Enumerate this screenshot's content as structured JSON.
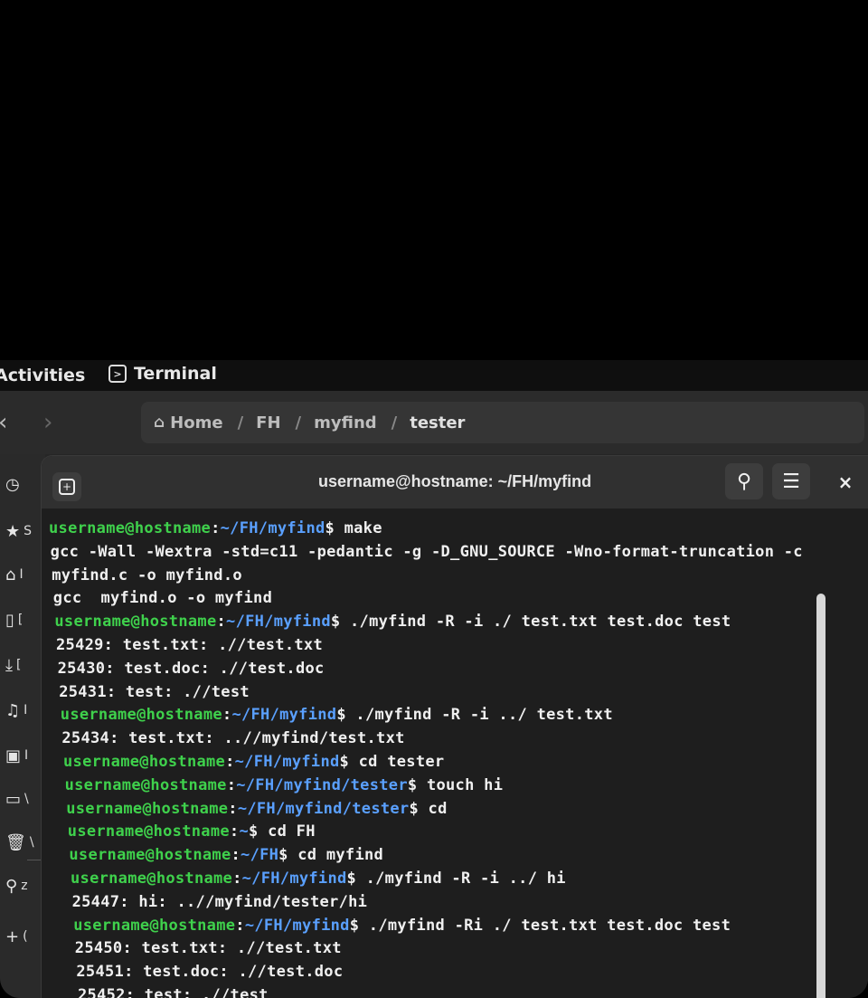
{
  "topbar": {
    "activities": "Activities",
    "app_name": "Terminal"
  },
  "files": {
    "breadcrumb": [
      "Home",
      "FH",
      "myfind",
      "tester"
    ],
    "separator": "/",
    "sidebar_letters": [
      "S",
      "I",
      "[",
      "[",
      "I",
      "I",
      "\\",
      "\\",
      "z",
      "("
    ]
  },
  "terminal": {
    "title": "username@hostname: ~/FH/myfind",
    "lines": [
      {
        "user": "username@hostname",
        "colon": ":",
        "path": "~/FH/myfind",
        "dollar": "$",
        "cmd": " make"
      },
      {
        "out": "gcc -Wall -Wextra -std=c11 -pedantic -g -D_GNU_SOURCE -Wno-format-truncation -c"
      },
      {
        "out": "myfind.c -o myfind.o"
      },
      {
        "out": "gcc  myfind.o -o myfind"
      },
      {
        "user": "username@hostname",
        "colon": ":",
        "path": "~/FH/myfind",
        "dollar": "$",
        "cmd": " ./myfind -R -i ./ test.txt test.doc test"
      },
      {
        "out": "25429: test.txt: .//test.txt"
      },
      {
        "out": "25430: test.doc: .//test.doc"
      },
      {
        "out": "25431: test: .//test"
      },
      {
        "user": "username@hostname",
        "colon": ":",
        "path": "~/FH/myfind",
        "dollar": "$",
        "cmd": " ./myfind -R -i ../ test.txt"
      },
      {
        "out": "25434: test.txt: ..//myfind/test.txt"
      },
      {
        "user": "username@hostname",
        "colon": ":",
        "path": "~/FH/myfind",
        "dollar": "$",
        "cmd": " cd tester"
      },
      {
        "user": "username@hostname",
        "colon": ":",
        "path": "~/FH/myfind/tester",
        "dollar": "$",
        "cmd": " touch hi"
      },
      {
        "user": "username@hostname",
        "colon": ":",
        "path": "~/FH/myfind/tester",
        "dollar": "$",
        "cmd": " cd"
      },
      {
        "user": "username@hostname",
        "colon": ":",
        "path": "~",
        "dollar": "$",
        "cmd": " cd FH"
      },
      {
        "user": "username@hostname",
        "colon": ":",
        "path": "~/FH",
        "dollar": "$",
        "cmd": " cd myfind"
      },
      {
        "user": "username@hostname",
        "colon": ":",
        "path": "~/FH/myfind",
        "dollar": "$",
        "cmd": " ./myfind -R -i ../ hi"
      },
      {
        "out": "25447: hi: ..//myfind/tester/hi"
      },
      {
        "user": "username@hostname",
        "colon": ":",
        "path": "~/FH/myfind",
        "dollar": "$",
        "cmd": " ./myfind -Ri ./ test.txt test.doc test"
      },
      {
        "out": "25450: test.txt: .//test.txt"
      },
      {
        "out": "25451: test.doc: .//test.doc"
      },
      {
        "out": "25452: test: .//test"
      }
    ]
  },
  "colors": {
    "prompt_user": "#3fd14c",
    "prompt_path": "#5aa0ff",
    "terminal_bg": "#1e1e1e",
    "header_bg": "#303030"
  }
}
